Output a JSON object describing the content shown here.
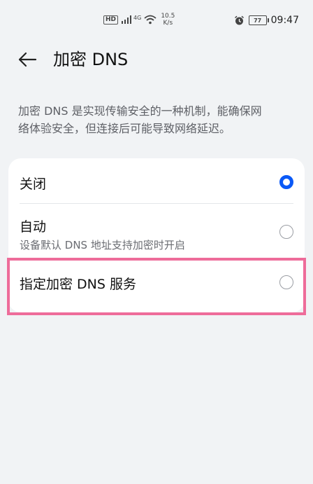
{
  "status_bar": {
    "hd_badge": "HD",
    "network_type": "4G",
    "speed_value": "10.5",
    "speed_unit": "K/s",
    "battery_level": "77",
    "time": "09:47"
  },
  "header": {
    "title": "加密 DNS"
  },
  "description": {
    "line1": "加密 DNS 是实现传输安全的一种机制，能确保网",
    "line2": "络体验安全，但连接后可能导致网络延迟。"
  },
  "options": [
    {
      "title": "关闭",
      "subtitle": "",
      "selected": true
    },
    {
      "title": "自动",
      "subtitle": "设备默认 DNS 地址支持加密时开启",
      "selected": false
    },
    {
      "title": "指定加密 DNS 服务",
      "subtitle": "",
      "selected": false
    }
  ],
  "colors": {
    "accent": "#0a59f7",
    "highlight": "#ee6c9a",
    "background": "#f1f3f5"
  }
}
